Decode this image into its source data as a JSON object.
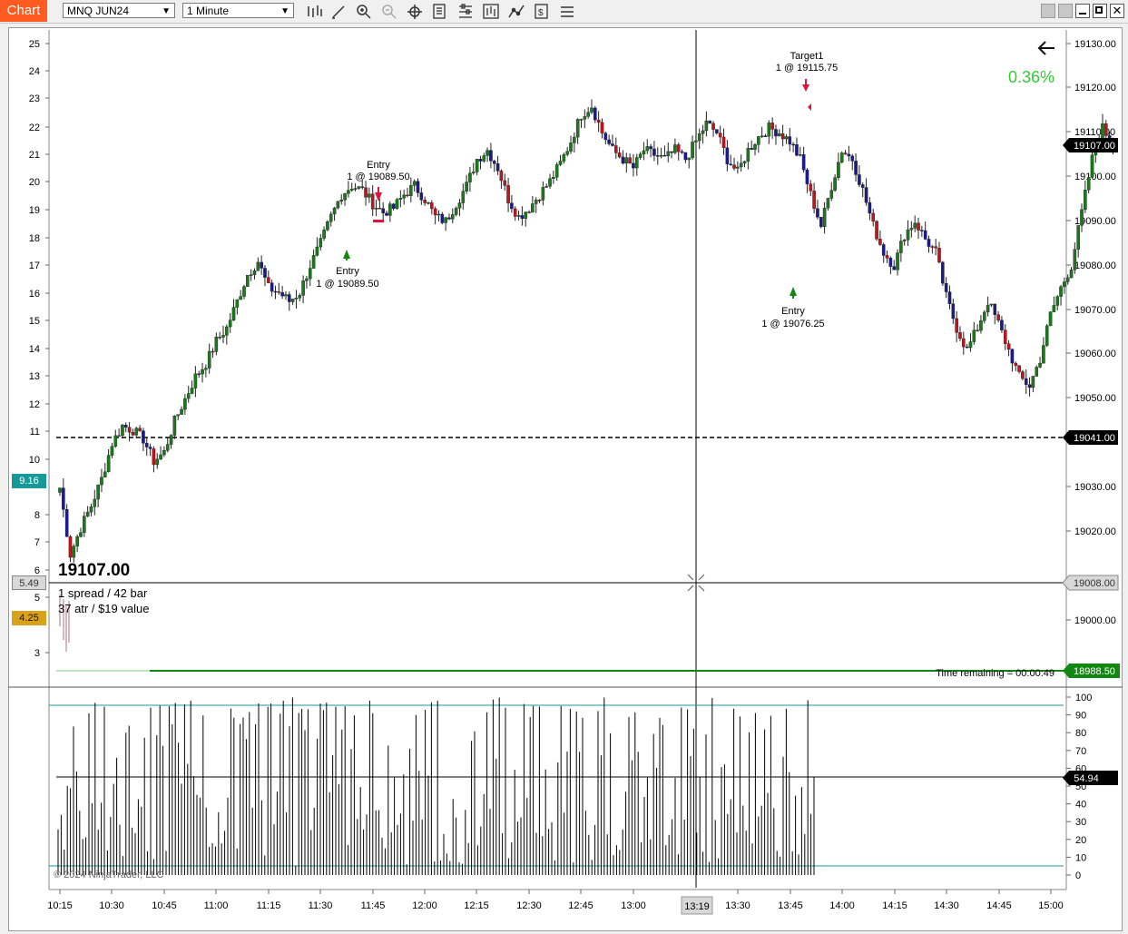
{
  "toolbar": {
    "chart_tab": "Chart",
    "instrument": "MNQ JUN24",
    "interval": "1 Minute"
  },
  "window_controls": {
    "restore": "restore",
    "minimize": "minimize",
    "maximize": "maximize",
    "close": "close"
  },
  "colors": {
    "up": "#1a7a1a",
    "down": "#c0141e",
    "neutral": "#1a1a8c",
    "change": "#33cc33",
    "cyan_box": "#17999a",
    "orange_box": "#d9a21b",
    "target_marker": "#e0143c",
    "entry_marker": "#118811"
  },
  "price_axis": {
    "ticks": [
      "19130.00",
      "19120.00",
      "19110.00",
      "19100.00",
      "19090.00",
      "19080.00",
      "19070.00",
      "19060.00",
      "19050.00",
      "19030.00",
      "19020.00",
      "19000.00"
    ],
    "current_price": "19107.00",
    "dashed_level": "19041.00",
    "cursor_level": "19008.00",
    "green_level": "18988.50"
  },
  "left_axis": {
    "ticks": [
      "25",
      "24",
      "23",
      "22",
      "21",
      "20",
      "19",
      "18",
      "17",
      "16",
      "15",
      "14",
      "13",
      "12",
      "11",
      "10",
      "8",
      "7",
      "6",
      "5",
      "3"
    ],
    "cyan_value": "9.16",
    "gray_value": "5.49",
    "orange_value": "4.25"
  },
  "indicator_axis": {
    "ticks": [
      "100",
      "90",
      "80",
      "70",
      "60",
      "50",
      "40",
      "30",
      "20",
      "10",
      "0"
    ],
    "current_value": "54.94"
  },
  "time_axis": {
    "ticks": [
      "10:15",
      "10:30",
      "10:45",
      "11:00",
      "11:15",
      "11:30",
      "11:45",
      "12:00",
      "12:15",
      "12:30",
      "12:45",
      "13:00",
      "13:30",
      "13:45",
      "14:00",
      "14:15",
      "14:30",
      "14:45",
      "15:00"
    ],
    "cursor_time": "13:19"
  },
  "info_panel": {
    "price": "19107.00",
    "spread": "1 spread / 42 bar",
    "atr": "37 atr / $19 value"
  },
  "change_percent": "0.36%",
  "time_remaining": "Time remaining = 00:00:49",
  "copyright": "© 2024 NinjaTrader, LLC",
  "executions": [
    {
      "name": "Entry",
      "detail": "1 @ 19089.50"
    },
    {
      "name": "Entry",
      "detail": "1 @ 19089.50"
    },
    {
      "name": "Entry",
      "detail": "1 @ 19076.25"
    },
    {
      "name": "Target1",
      "detail": "1 @ 19115.75"
    }
  ],
  "chart_data": {
    "type": "candlestick",
    "interval": "1 Minute",
    "instrument": "MNQ JUN24",
    "x_start": "10:15",
    "ylim": [
      18975,
      19135
    ],
    "close_trend": [
      19030,
      19015,
      19021,
      19026,
      19032,
      19040,
      19044,
      19043,
      19041,
      19036,
      19038,
      19045,
      19050,
      19055,
      19058,
      19063,
      19066,
      19072,
      19078,
      19081,
      19075,
      19074,
      19072,
      19074,
      19080,
      19085,
      19091,
      19096,
      19098,
      19097,
      19094,
      19092,
      19093,
      19096,
      19098,
      19095,
      19091,
      19090,
      19094,
      19098,
      19104,
      19106,
      19102,
      19095,
      19091,
      19093,
      19096,
      19099,
      19103,
      19108,
      19114,
      19116,
      19110,
      19106,
      19104,
      19102,
      19106,
      19105,
      19104,
      19106,
      19104,
      19108,
      19112,
      19110,
      19104,
      19101,
      19106,
      19109,
      19111,
      19110,
      19108,
      19104,
      19096,
      19089,
      19098,
      19106,
      19104,
      19097,
      19089,
      19083,
      19080,
      19087,
      19090,
      19086,
      19083,
      19073,
      19066,
      19061,
      19066,
      19072,
      19067,
      19061,
      19055,
      19053,
      19059,
      19069,
      19075,
      19080,
      19092,
      19104,
      19111,
      19107
    ],
    "indicator": {
      "ylim": [
        0,
        100
      ],
      "upper_band": 95,
      "lower_band": 5,
      "current": 54.94
    }
  }
}
